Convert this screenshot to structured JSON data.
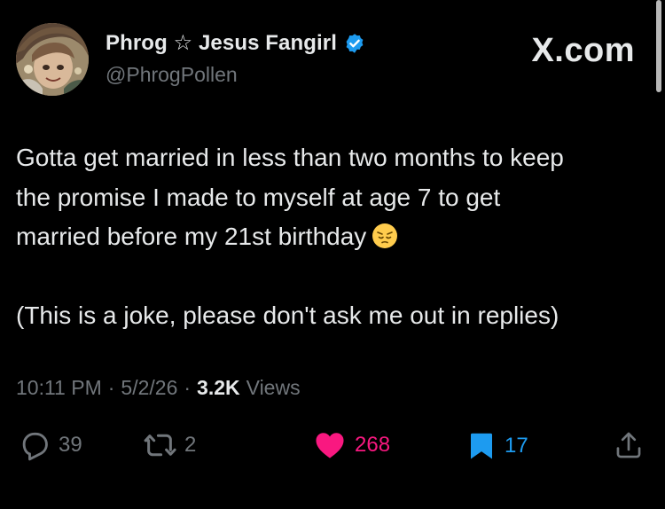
{
  "author": {
    "display_name": "Phrog ☆ Jesus Fangirl",
    "handle": "@PhrogPollen",
    "verified": true,
    "avatar_icon": "profile-avatar"
  },
  "brand": "X.com",
  "tweet": {
    "line1": "Gotta get married in less than two months to keep",
    "line2": "the promise I made to myself at age 7 to get",
    "line3": "married before my 21st birthday",
    "emoji": "pensive-face",
    "line4": "(This is a joke, please don't ask me out in replies)"
  },
  "meta": {
    "time": "10:11 PM",
    "separator": "·",
    "date": "5/2/26",
    "views_count": "3.2K",
    "views_label": "Views"
  },
  "actions": {
    "reply_count": "39",
    "repost_count": "2",
    "like_count": "268",
    "bookmark_count": "17"
  },
  "colors": {
    "background": "#000000",
    "text": "#e7e9ea",
    "muted": "#71767b",
    "like": "#f91880",
    "bookmark": "#1d9bf0",
    "verified": "#1d9bf0"
  }
}
